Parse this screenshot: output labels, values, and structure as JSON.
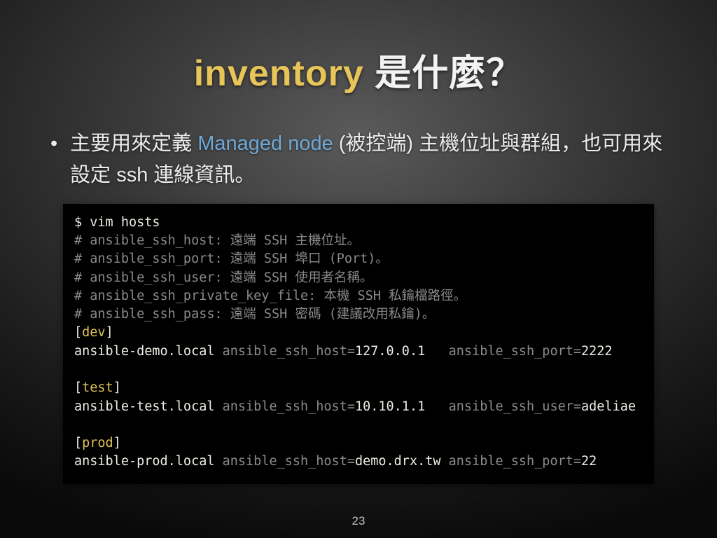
{
  "title": {
    "keyword": "inventory",
    "rest": " 是什麼？"
  },
  "bullet": {
    "dot": "•",
    "pre": "主要用來定義 ",
    "emph": "Managed node",
    "post": " (被控端) 主機位址與群組，也可用來設定 ssh 連線資訊。"
  },
  "code": {
    "prompt": "$ vim hosts",
    "comments": [
      "# ansible_ssh_host: 遠端 SSH 主機位址。",
      "# ansible_ssh_port: 遠端 SSH 埠口 (Port)。",
      "# ansible_ssh_user: 遠端 SSH 使用者名稱。",
      "# ansible_ssh_private_key_file: 本機 SSH 私鑰檔路徑。",
      "# ansible_ssh_pass: 遠端 SSH 密碼 (建議改用私鑰)。"
    ],
    "groups": [
      {
        "name": "dev",
        "host": "ansible-demo.local",
        "items": [
          {
            "key": "ansible_ssh_host",
            "val": "127.0.0.1"
          },
          {
            "key": "ansible_ssh_port",
            "val": "2222"
          }
        ]
      },
      {
        "name": "test",
        "host": "ansible-test.local",
        "items": [
          {
            "key": "ansible_ssh_host",
            "val": "10.10.1.1"
          },
          {
            "key": "ansible_ssh_user",
            "val": "adeliae"
          }
        ]
      },
      {
        "name": "prod",
        "host": "ansible-prod.local",
        "items": [
          {
            "key": "ansible_ssh_host",
            "val": "demo.drx.tw"
          },
          {
            "key": "ansible_ssh_port",
            "val": "22"
          }
        ]
      }
    ]
  },
  "page": "23"
}
